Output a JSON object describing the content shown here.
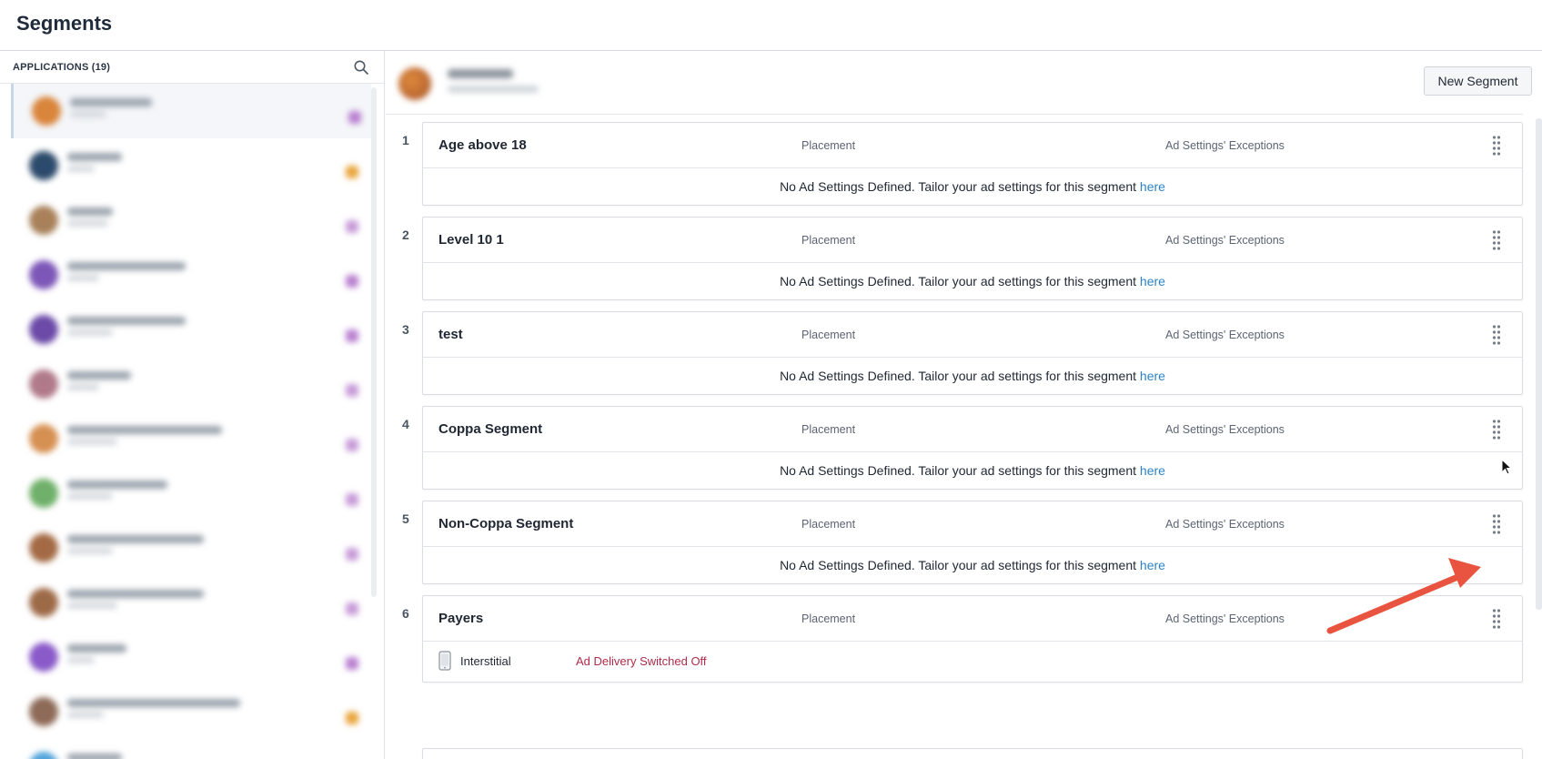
{
  "page": {
    "title": "Segments"
  },
  "sidebar": {
    "apps_label": "APPLICATIONS (19)",
    "search_icon": "search-icon",
    "apps": [
      {
        "color": "#d9853b",
        "name_w": 90,
        "sub_w": 40,
        "badge": "#b97fd0",
        "selected": true
      },
      {
        "color": "#2c4a6b",
        "name_w": 60,
        "sub_w": 30,
        "badge": "#e9a43a"
      },
      {
        "color": "#a8815a",
        "name_w": 50,
        "sub_w": 45,
        "badge": "#c79ad8"
      },
      {
        "color": "#7d57b8",
        "name_w": 130,
        "sub_w": 35,
        "badge": "#b97fd0"
      },
      {
        "color": "#6b4aa8",
        "name_w": 130,
        "sub_w": 50,
        "badge": "#b97fd0"
      },
      {
        "color": "#b07a8a",
        "name_w": 70,
        "sub_w": 35,
        "badge": "#c79ad8"
      },
      {
        "color": "#d69052",
        "name_w": 170,
        "sub_w": 55,
        "badge": "#c79ad8"
      },
      {
        "color": "#6fb06a",
        "name_w": 110,
        "sub_w": 50,
        "badge": "#c79ad8"
      },
      {
        "color": "#a36a45",
        "name_w": 150,
        "sub_w": 50,
        "badge": "#c79ad8"
      },
      {
        "color": "#9d6a48",
        "name_w": 150,
        "sub_w": 55,
        "badge": "#c79ad8"
      },
      {
        "color": "#8a5ac9",
        "name_w": 65,
        "sub_w": 30,
        "badge": "#b97fd0"
      },
      {
        "color": "#8e6a58",
        "name_w": 190,
        "sub_w": 40,
        "badge": "#e9a43a"
      },
      {
        "color": "#4fa3d9",
        "name_w": 60,
        "sub_w": 30,
        "badge": "#c79ad8"
      }
    ]
  },
  "toolbar": {
    "new_segment_label": "New Segment"
  },
  "segments": {
    "column_placement": "Placement",
    "column_exceptions": "Ad Settings' Exceptions",
    "empty_message": "No Ad Settings Defined. Tailor your ad settings for this segment ",
    "empty_link": "here",
    "items": [
      {
        "number": "1",
        "name": "Age above 18"
      },
      {
        "number": "2",
        "name": "Level 10 1"
      },
      {
        "number": "3",
        "name": "test"
      },
      {
        "number": "4",
        "name": "Coppa Segment"
      },
      {
        "number": "5",
        "name": "Non-Coppa Segment"
      },
      {
        "number": "6",
        "name": "Payers",
        "detail": {
          "type": "Interstitial",
          "status": "Ad Delivery Switched Off",
          "icon": "phone-icon"
        }
      }
    ]
  },
  "colors": {
    "link": "#2d84c7",
    "status_off": "#b02b4a",
    "annotation_arrow": "#e8543f"
  }
}
